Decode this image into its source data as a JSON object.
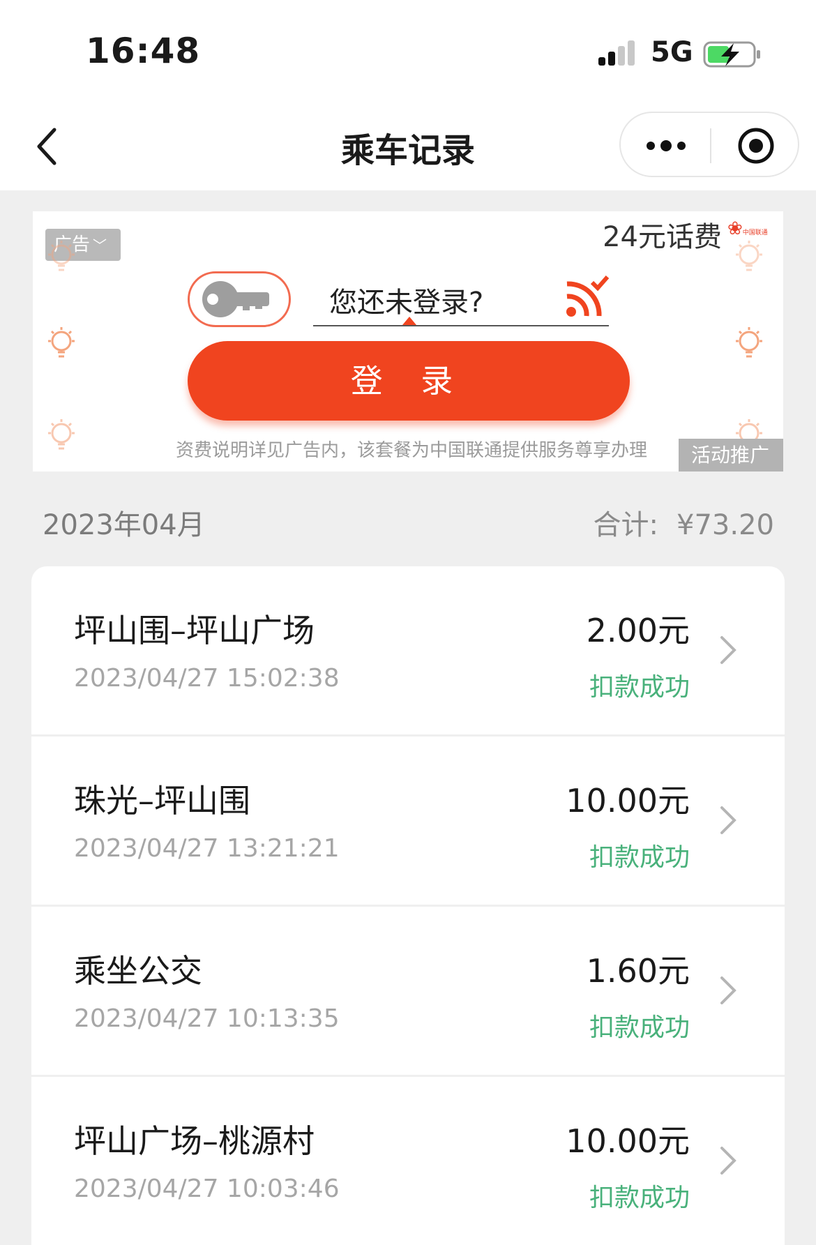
{
  "status_bar": {
    "time": "16:48",
    "network": "5G"
  },
  "nav": {
    "title": "乘车记录"
  },
  "ad": {
    "tag": "广告",
    "promo_text": "24元话费",
    "carrier_logo_text": "中国联通",
    "prompt": "您还未登录?",
    "login_button": "登 录",
    "footnote": "资费说明详见广告内，该套餐为中国联通提供服务尊享办理",
    "badge": "活动推广"
  },
  "summary": {
    "month": "2023年04月",
    "total_label": "合计:",
    "total_value": "¥73.20"
  },
  "records": [
    {
      "route": "坪山围–坪山广场",
      "datetime": "2023/04/27 15:02:38",
      "amount": "2.00元",
      "status": "扣款成功"
    },
    {
      "route": "珠光–坪山围",
      "datetime": "2023/04/27 13:21:21",
      "amount": "10.00元",
      "status": "扣款成功"
    },
    {
      "route": "乘坐公交",
      "datetime": "2023/04/27 10:13:35",
      "amount": "1.60元",
      "status": "扣款成功"
    },
    {
      "route": "坪山广场–桃源村",
      "datetime": "2023/04/27 10:03:46",
      "amount": "10.00元",
      "status": "扣款成功"
    }
  ],
  "colors": {
    "accent": "#f0441f",
    "success": "#49b17b",
    "background": "#efefef"
  }
}
